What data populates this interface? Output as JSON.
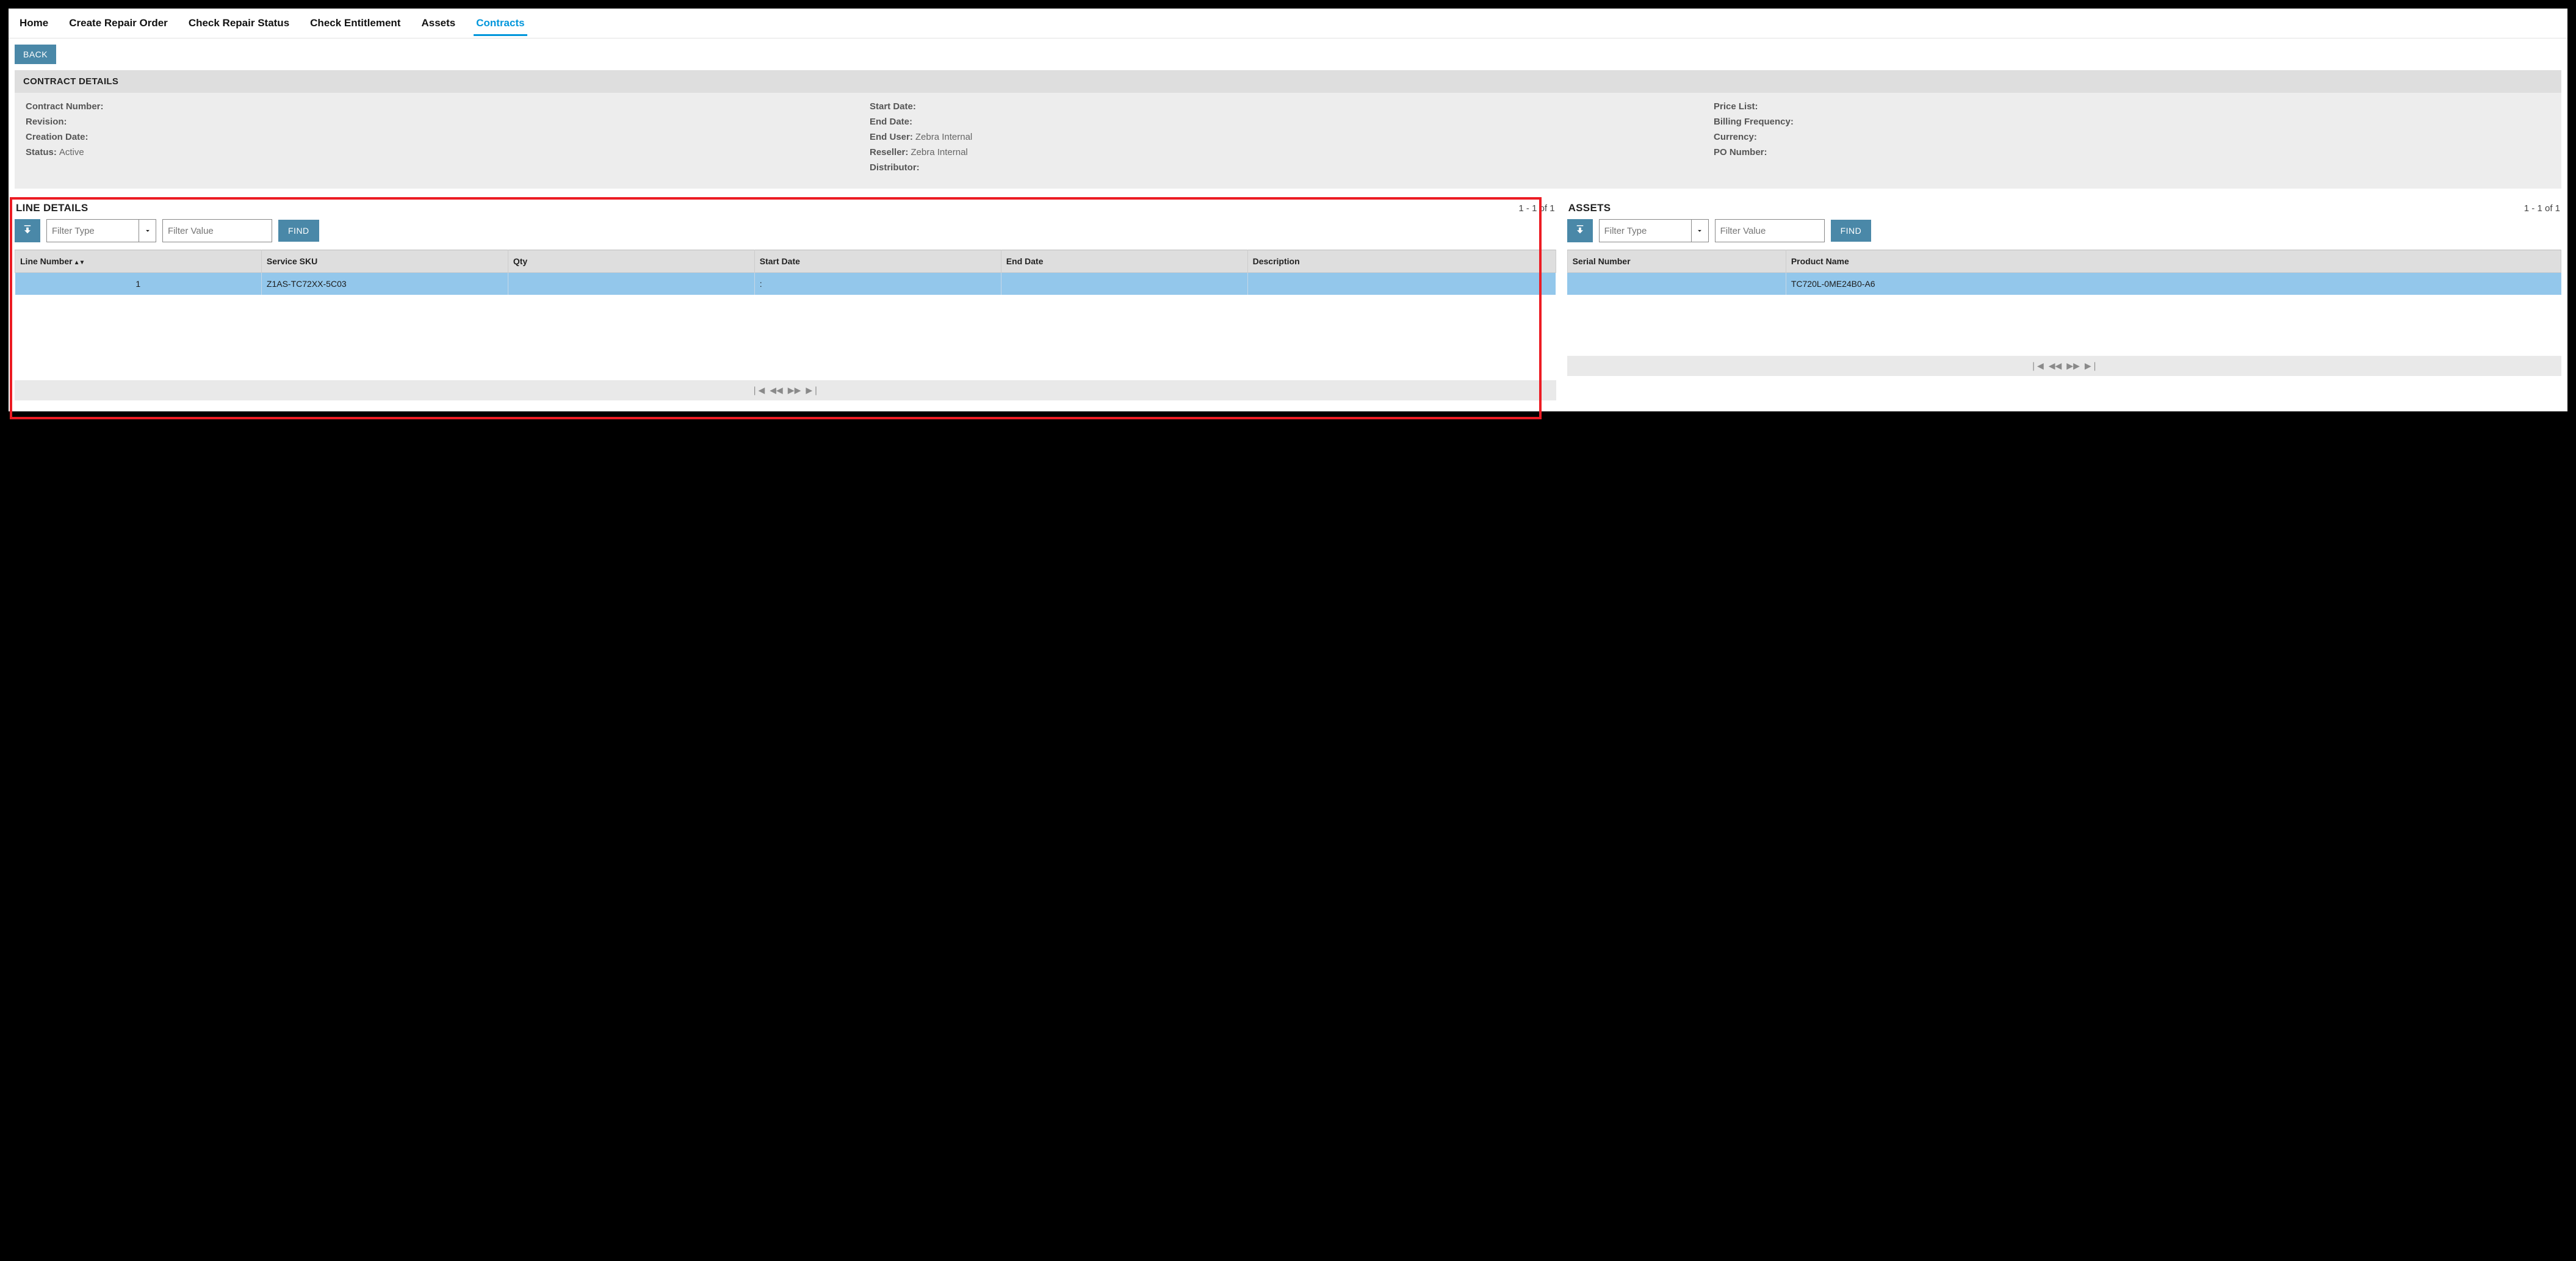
{
  "nav": {
    "items": [
      {
        "label": "Home"
      },
      {
        "label": "Create Repair Order"
      },
      {
        "label": "Check Repair Status"
      },
      {
        "label": "Check Entitlement"
      },
      {
        "label": "Assets"
      },
      {
        "label": "Contracts",
        "active": true
      }
    ]
  },
  "back_label": "BACK",
  "contract_details": {
    "title": "CONTRACT DETAILS",
    "col1": {
      "contract_number_label": "Contract Number:",
      "contract_number_value": "",
      "revision_label": "Revision:",
      "revision_value": "",
      "creation_date_label": "Creation Date:",
      "creation_date_value": "",
      "status_label": "Status:",
      "status_value": "Active"
    },
    "col2": {
      "start_date_label": "Start Date:",
      "start_date_value": "",
      "end_date_label": "End Date:",
      "end_date_value": "",
      "end_user_label": "End User:",
      "end_user_value": "Zebra Internal",
      "reseller_label": "Reseller:",
      "reseller_value": "Zebra Internal",
      "distributor_label": "Distributor:",
      "distributor_value": ""
    },
    "col3": {
      "price_list_label": "Price List:",
      "price_list_value": "",
      "billing_frequency_label": "Billing Frequency:",
      "billing_frequency_value": "",
      "currency_label": "Currency:",
      "currency_value": "",
      "po_number_label": "PO Number:",
      "po_number_value": ""
    }
  },
  "line_details": {
    "title": "LINE DETAILS",
    "count": "1 - 1 of 1",
    "filter_type_placeholder": "Filter Type",
    "filter_value_placeholder": "Filter Value",
    "find_label": "FIND",
    "columns": {
      "line_number": "Line Number",
      "service_sku": "Service SKU",
      "qty": "Qty",
      "start_date": "Start Date",
      "end_date": "End Date",
      "description": "Description"
    },
    "rows": [
      {
        "line_number": "1",
        "service_sku": "Z1AS-TC72XX-5C03",
        "qty": "",
        "start_date": ":",
        "end_date": "",
        "description": ""
      }
    ]
  },
  "assets": {
    "title": "ASSETS",
    "count": "1 - 1 of 1",
    "filter_type_placeholder": "Filter Type",
    "filter_value_placeholder": "Filter Value",
    "find_label": "FIND",
    "columns": {
      "serial_number": "Serial Number",
      "product_name": "Product Name"
    },
    "rows": [
      {
        "serial_number": "",
        "product_name": "TC720L-0ME24B0-A6"
      }
    ]
  },
  "pager": {
    "first": "❘◀",
    "prev": "◀◀",
    "next": "▶▶",
    "last": "▶❘"
  }
}
